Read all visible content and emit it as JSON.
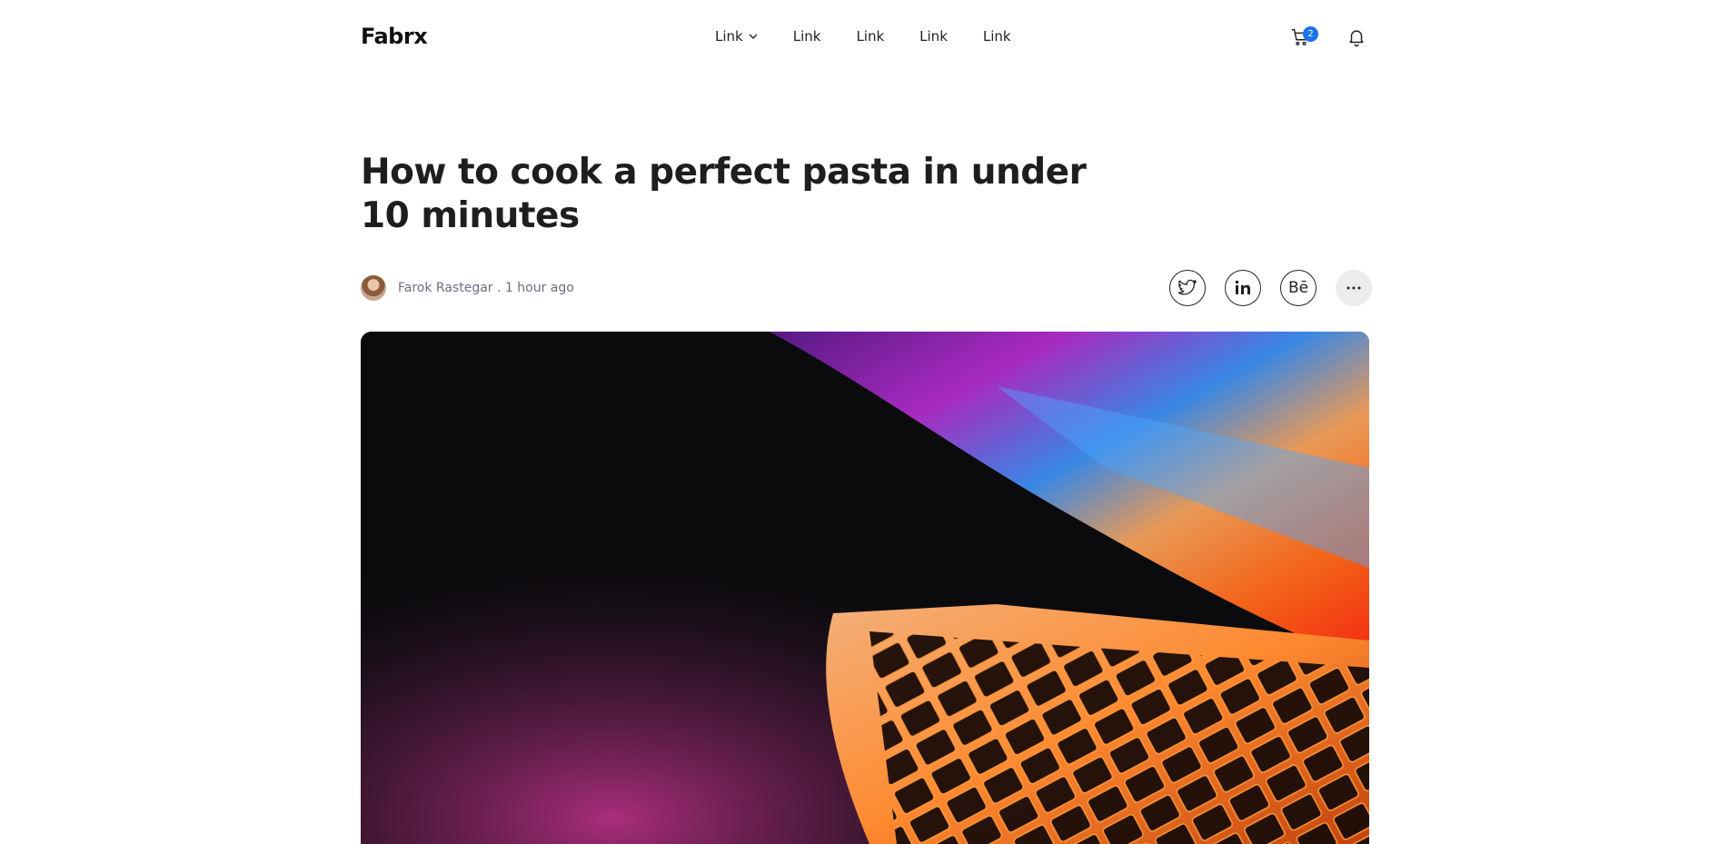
{
  "navbar": {
    "logo": "Fabrx",
    "links": [
      {
        "label": "Link",
        "has_dropdown": true
      },
      {
        "label": "Link",
        "has_dropdown": false
      },
      {
        "label": "Link",
        "has_dropdown": false
      },
      {
        "label": "Link",
        "has_dropdown": false
      },
      {
        "label": "Link",
        "has_dropdown": false
      }
    ],
    "cart_count": "2",
    "icons": [
      "cart-icon",
      "bell-icon",
      "chevron-down-icon"
    ],
    "badge_color": "#1a73e8"
  },
  "article": {
    "title": "How to cook a perfect pasta in under 10 minutes",
    "author": "Farok Rastegar",
    "separator": " . ",
    "time": "1 hour ago",
    "share_icons": [
      "twitter-icon",
      "linkedin-icon",
      "behance-icon",
      "more-icon"
    ],
    "behance_label": "Bē",
    "hero_image": "laptop keyboard with colorful light"
  }
}
